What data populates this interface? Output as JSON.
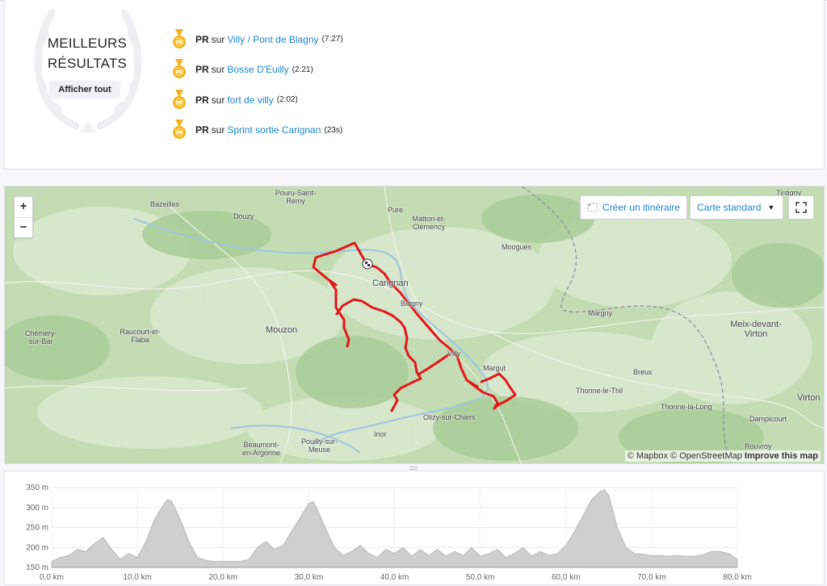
{
  "best_results": {
    "title": "MEILLEURS RÉSULTATS",
    "show_all_label": "Afficher tout",
    "items": [
      {
        "badge": "PR",
        "prefix": "sur",
        "segment": "Villy / Pont de Blagny",
        "time": "(7:27)"
      },
      {
        "badge": "PR",
        "prefix": "sur",
        "segment": "Bosse D'Euilly",
        "time": "(2:21)"
      },
      {
        "badge": "PR",
        "prefix": "sur",
        "segment": "fort de villy",
        "time": "(2:02)"
      },
      {
        "badge": "PR",
        "prefix": "sur",
        "segment": "Sprint sortie Carignan",
        "time": "(23s)"
      }
    ]
  },
  "map": {
    "zoom_in_label": "+",
    "zoom_out_label": "−",
    "create_route_label": "Créer un itinéraire",
    "map_style_label": "Carte standard",
    "attribution": "© Mapbox © OpenStreetMap",
    "improve_label": "Improve this map",
    "route_color": "#e3161b",
    "places": [
      "Tintigny",
      "Pouru-Saint-Remy",
      "Bazeilles",
      "Douzy",
      "Pure",
      "Matton-et-Clémency",
      "Moogues",
      "Carignan",
      "Blagny",
      "Margny",
      "Meix-devant-Virton",
      "Chémery-sur-Bar",
      "Raucourt-et-Flaba",
      "Mouzon",
      "Villy",
      "Margut",
      "Breux",
      "Thonne-le-Thil",
      "Virton",
      "Thonne-la-Long",
      "Dampicourt",
      "Olizy-sur-Chiers",
      "Inor",
      "Beaumont-en-Argonne",
      "Pouilly-sur-Meuse",
      "Rouvroy"
    ]
  },
  "chart_data": {
    "type": "area",
    "x_unit": "km",
    "y_unit": "m",
    "xlim": [
      0,
      80
    ],
    "ylim": [
      150,
      350
    ],
    "x_ticks": [
      "0,0 km",
      "10,0 km",
      "20,0 km",
      "30,0 km",
      "40,0 km",
      "50,0 km",
      "60,0 km",
      "70,0 km",
      "80,0 km"
    ],
    "y_ticks": [
      "350 m",
      "300 m",
      "250 m",
      "200 m",
      "150 m"
    ],
    "grid": true,
    "fill_color": "#cfcfcf",
    "x": [
      0,
      1,
      2,
      3,
      4,
      5,
      6,
      7,
      8,
      9,
      10,
      11,
      12,
      13,
      13.5,
      14,
      15,
      16,
      17,
      18,
      19,
      20,
      21,
      22,
      23,
      24,
      25,
      26,
      27,
      28,
      29,
      30,
      30.5,
      31,
      32,
      33,
      34,
      35,
      36,
      37,
      38,
      39,
      40,
      41,
      42,
      43,
      44,
      45,
      46,
      47,
      48,
      49,
      50,
      51,
      52,
      53,
      54,
      55,
      56,
      57,
      58,
      59,
      60,
      61,
      62,
      63,
      64,
      64.5,
      65,
      66,
      67,
      68,
      69,
      70,
      71,
      72,
      73,
      74,
      75,
      76,
      77,
      78,
      79,
      80
    ],
    "y": [
      165,
      175,
      180,
      195,
      190,
      210,
      225,
      195,
      170,
      185,
      175,
      215,
      270,
      305,
      320,
      315,
      270,
      215,
      175,
      168,
      165,
      165,
      165,
      165,
      170,
      200,
      215,
      195,
      205,
      240,
      275,
      310,
      315,
      295,
      245,
      200,
      180,
      190,
      205,
      185,
      175,
      195,
      185,
      200,
      178,
      195,
      180,
      195,
      178,
      190,
      180,
      200,
      178,
      185,
      195,
      175,
      185,
      200,
      178,
      190,
      180,
      185,
      205,
      240,
      280,
      320,
      340,
      345,
      330,
      250,
      200,
      185,
      183,
      180,
      180,
      178,
      180,
      178,
      178,
      182,
      190,
      190,
      185,
      170
    ]
  }
}
